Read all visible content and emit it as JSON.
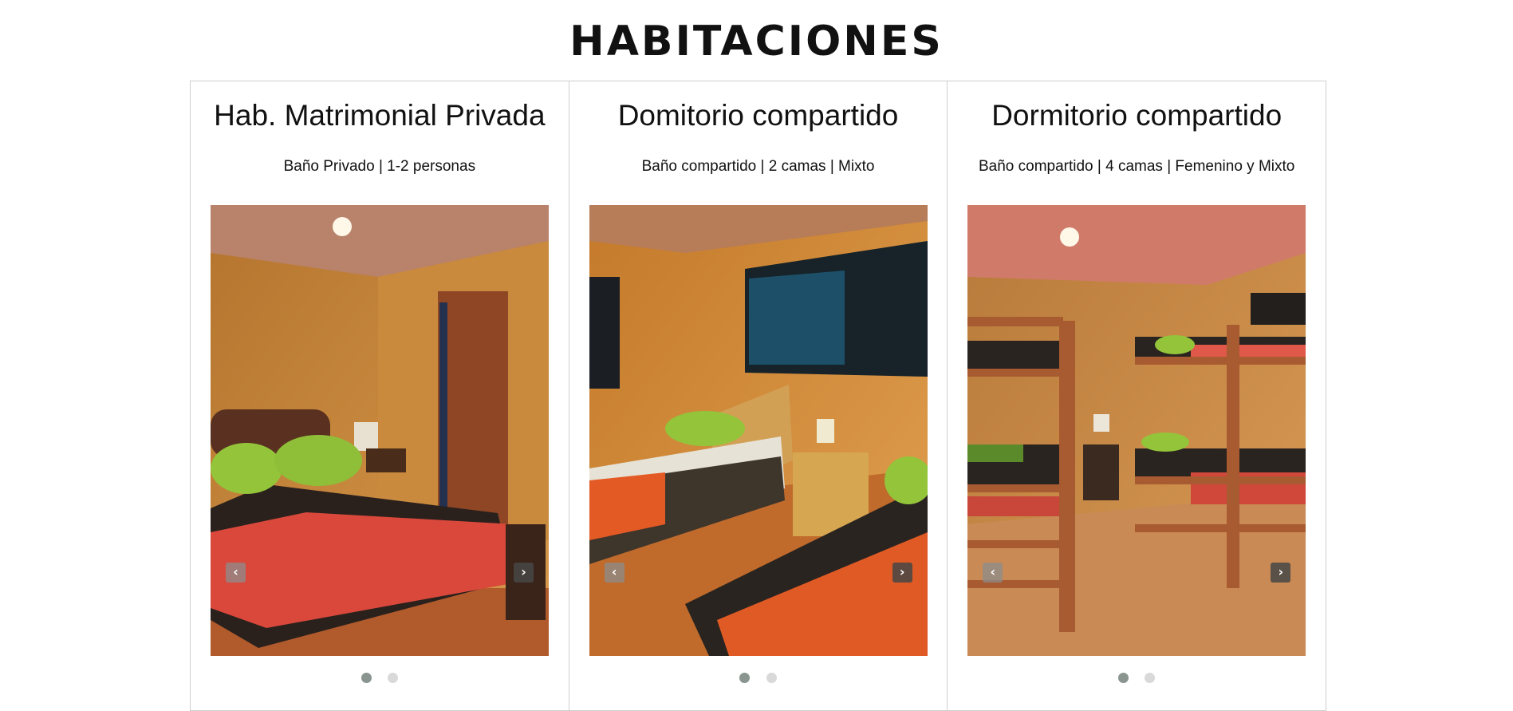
{
  "page": {
    "title": "HABITACIONES"
  },
  "rooms": [
    {
      "title": "Hab. Matrimonial Privada",
      "subtitle": "Baño Privado | 1-2 personas",
      "prev_glyph": "‹",
      "next_glyph": "›",
      "slide_count": 2,
      "active_slide": 1
    },
    {
      "title": "Domitorio compartido",
      "subtitle": "Baño compartido | 2 camas | Mixto",
      "prev_glyph": "‹",
      "next_glyph": "›",
      "slide_count": 2,
      "active_slide": 1
    },
    {
      "title": "Dormitorio compartido",
      "subtitle": "Baño compartido | 4 camas | Femenino y Mixto",
      "prev_glyph": "‹",
      "next_glyph": "›",
      "slide_count": 2,
      "active_slide": 1
    }
  ],
  "colors": {
    "border": "#cfcfcf",
    "dot_active": "#8a9590",
    "dot_inactive": "#d9d9d9",
    "wood": "#c9822f",
    "blanket_red": "#d9483b",
    "pillow_green": "#93c43a"
  }
}
